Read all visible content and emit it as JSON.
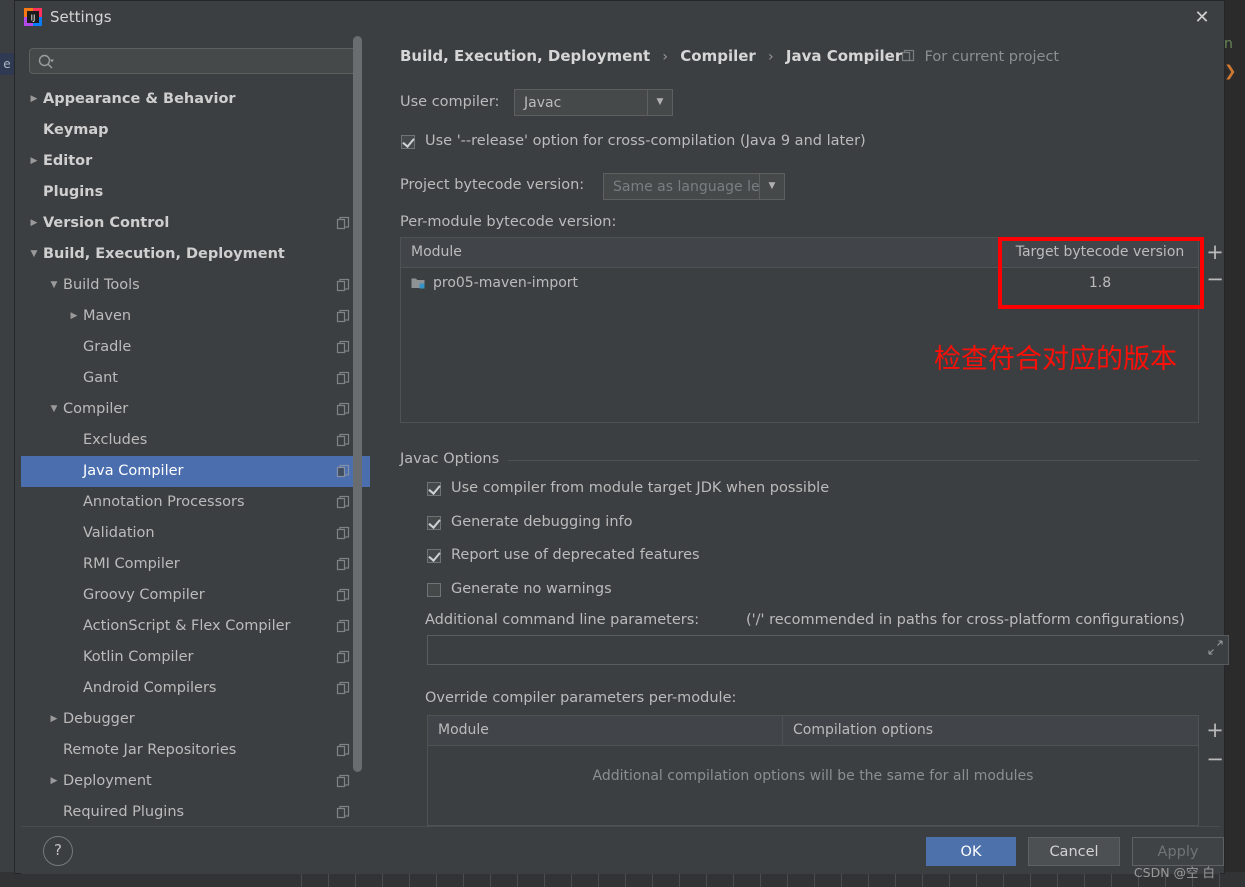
{
  "window": {
    "title": "Settings",
    "app_icon": "intellij-idea-icon",
    "close_icon": "close-icon"
  },
  "search": {
    "value": "",
    "placeholder": "",
    "icon": "search-icon"
  },
  "sidebar": {
    "items": [
      {
        "label": "Appearance & Behavior",
        "arrow": "collapsed",
        "indent": 0,
        "group": true,
        "config": false,
        "selected": false
      },
      {
        "label": "Keymap",
        "arrow": "none",
        "indent": 0,
        "group": true,
        "config": false,
        "selected": false
      },
      {
        "label": "Editor",
        "arrow": "collapsed",
        "indent": 0,
        "group": true,
        "config": false,
        "selected": false
      },
      {
        "label": "Plugins",
        "arrow": "none",
        "indent": 0,
        "group": true,
        "config": false,
        "selected": false
      },
      {
        "label": "Version Control",
        "arrow": "collapsed",
        "indent": 0,
        "group": true,
        "config": true,
        "selected": false
      },
      {
        "label": "Build, Execution, Deployment",
        "arrow": "expanded",
        "indent": 0,
        "group": true,
        "config": false,
        "selected": false
      },
      {
        "label": "Build Tools",
        "arrow": "expanded",
        "indent": 1,
        "group": false,
        "config": true,
        "selected": false
      },
      {
        "label": "Maven",
        "arrow": "collapsed",
        "indent": 2,
        "group": false,
        "config": true,
        "selected": false
      },
      {
        "label": "Gradle",
        "arrow": "none",
        "indent": 2,
        "group": false,
        "config": true,
        "selected": false
      },
      {
        "label": "Gant",
        "arrow": "none",
        "indent": 2,
        "group": false,
        "config": true,
        "selected": false
      },
      {
        "label": "Compiler",
        "arrow": "expanded",
        "indent": 1,
        "group": false,
        "config": true,
        "selected": false
      },
      {
        "label": "Excludes",
        "arrow": "none",
        "indent": 2,
        "group": false,
        "config": true,
        "selected": false
      },
      {
        "label": "Java Compiler",
        "arrow": "none",
        "indent": 2,
        "group": false,
        "config": true,
        "selected": true
      },
      {
        "label": "Annotation Processors",
        "arrow": "none",
        "indent": 2,
        "group": false,
        "config": true,
        "selected": false
      },
      {
        "label": "Validation",
        "arrow": "none",
        "indent": 2,
        "group": false,
        "config": true,
        "selected": false
      },
      {
        "label": "RMI Compiler",
        "arrow": "none",
        "indent": 2,
        "group": false,
        "config": true,
        "selected": false
      },
      {
        "label": "Groovy Compiler",
        "arrow": "none",
        "indent": 2,
        "group": false,
        "config": true,
        "selected": false
      },
      {
        "label": "ActionScript & Flex Compiler",
        "arrow": "none",
        "indent": 2,
        "group": false,
        "config": true,
        "selected": false
      },
      {
        "label": "Kotlin Compiler",
        "arrow": "none",
        "indent": 2,
        "group": false,
        "config": true,
        "selected": false
      },
      {
        "label": "Android Compilers",
        "arrow": "none",
        "indent": 2,
        "group": false,
        "config": true,
        "selected": false
      },
      {
        "label": "Debugger",
        "arrow": "collapsed",
        "indent": 1,
        "group": false,
        "config": false,
        "selected": false
      },
      {
        "label": "Remote Jar Repositories",
        "arrow": "none",
        "indent": 1,
        "group": false,
        "config": true,
        "selected": false
      },
      {
        "label": "Deployment",
        "arrow": "collapsed",
        "indent": 1,
        "group": false,
        "config": true,
        "selected": false
      },
      {
        "label": "Required Plugins",
        "arrow": "none",
        "indent": 1,
        "group": false,
        "config": true,
        "selected": false
      }
    ]
  },
  "breadcrumb": {
    "part1": "Build, Execution, Deployment",
    "part2": "Compiler",
    "part3": "Java Compiler",
    "separator": "›",
    "scope_label": "For current project",
    "scope_icon": "project-scope-icon"
  },
  "compiler": {
    "use_compiler_label": "Use compiler:",
    "use_compiler_value": "Javac",
    "release_option_label": "Use '--release' option for cross-compilation (Java 9 and later)",
    "release_option_checked": true,
    "project_bytecode_label": "Project bytecode version:",
    "project_bytecode_value": "Same as language level",
    "per_module_label": "Per-module bytecode version:",
    "add_icon": "plus-icon",
    "remove_icon": "minus-icon"
  },
  "module_table": {
    "columns": [
      "Module",
      "Target bytecode version"
    ],
    "rows": [
      {
        "module": "pro05-maven-import",
        "target": "1.8",
        "icon": "module-folder-icon"
      }
    ]
  },
  "javac_options": {
    "caption": "Javac Options",
    "checkboxes": [
      {
        "label": "Use compiler from module target JDK when possible",
        "checked": true
      },
      {
        "label": "Generate debugging info",
        "checked": true
      },
      {
        "label": "Report use of deprecated features",
        "checked": true
      },
      {
        "label": "Generate no warnings",
        "checked": false
      }
    ],
    "additional_params_label": "Additional command line parameters:",
    "additional_params_hint": "('/' recommended in paths for cross-platform configurations)",
    "additional_params_value": "",
    "expand_icon": "expand-icon"
  },
  "override_table": {
    "label": "Override compiler parameters per-module:",
    "columns": [
      "Module",
      "Compilation options"
    ],
    "empty_message": "Additional compilation options will be the same for all modules",
    "add_icon": "plus-icon",
    "remove_icon": "minus-icon"
  },
  "annotation": {
    "text": "检查符合对应的版本",
    "color": "#fa1008",
    "box_color": "#ff0000"
  },
  "footer": {
    "help_label": "?",
    "ok": "OK",
    "cancel": "Cancel",
    "apply": "Apply",
    "apply_disabled": true,
    "watermark": "CSDN @空 白"
  },
  "background": {
    "left_tab_text": "e",
    "code_fragment": "n",
    "code_chevron": "❯"
  },
  "colors": {
    "dialog_bg": "#3c3f41",
    "selection": "#4b6eaf",
    "primary_button": "#4c71ab",
    "annotation_red": "#ff0000"
  }
}
